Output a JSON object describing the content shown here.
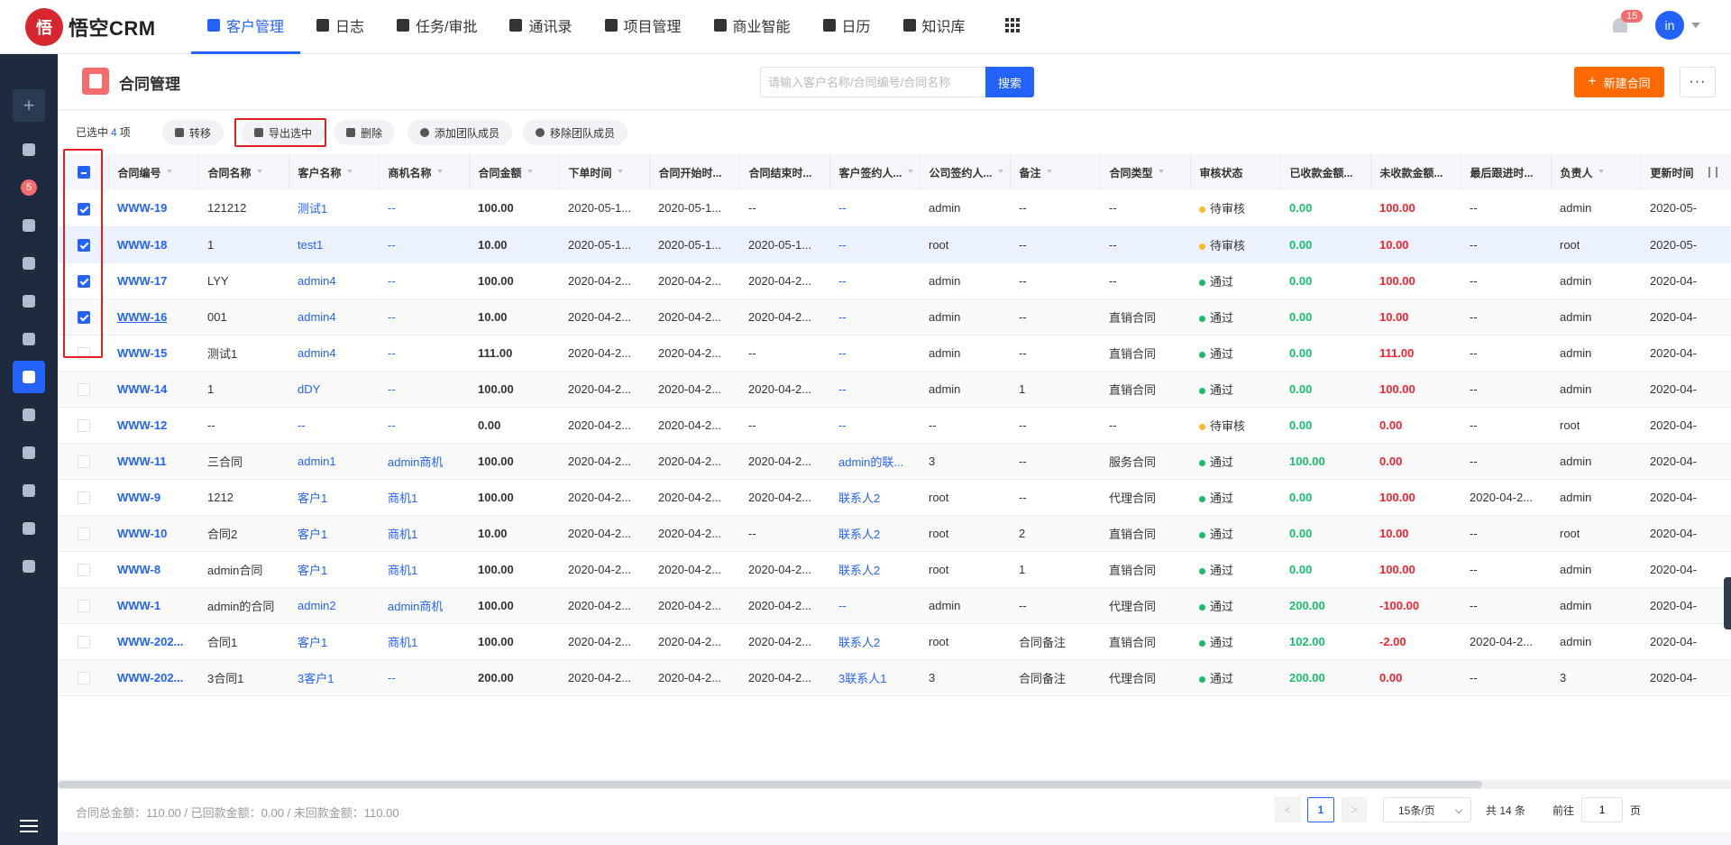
{
  "app": {
    "logo_text": "悟空CRM",
    "logo_mark": "悟"
  },
  "nav": [
    {
      "label": "客户管理",
      "active": true
    },
    {
      "label": "日志"
    },
    {
      "label": "任务/审批"
    },
    {
      "label": "通讯录"
    },
    {
      "label": "项目管理"
    },
    {
      "label": "商业智能"
    },
    {
      "label": "日历"
    },
    {
      "label": "知识库"
    }
  ],
  "notifications": {
    "count": "15"
  },
  "user": {
    "avatar_text": "in"
  },
  "sidebar": {
    "add_label": "+",
    "badge": "5"
  },
  "page": {
    "title": "合同管理"
  },
  "search": {
    "placeholder": "请输入客户名称/合同编号/合同名称",
    "button": "搜索"
  },
  "actions": {
    "new_label": "新建合同",
    "new_icon": "+",
    "more": "···"
  },
  "toolbar": {
    "selected_prefix": "已选中",
    "selected_count": "4",
    "selected_suffix": "项",
    "transfer": "转移",
    "export": "导出选中",
    "delete": "删除",
    "add_member": "添加团队成员",
    "remove_member": "移除团队成员"
  },
  "columns": [
    "合同编号",
    "合同名称",
    "客户名称",
    "商机名称",
    "合同金额",
    "下单时间",
    "合同开始时...",
    "合同结束时...",
    "客户签约人...",
    "公司签约人...",
    "备注",
    "合同类型",
    "审核状态",
    "已收款金额...",
    "未收款金额...",
    "最后跟进时...",
    "负责人",
    "更新时间"
  ],
  "rows": [
    {
      "checked": true,
      "code": "WWW-19",
      "name": "121212",
      "customer": "测试1",
      "opportunity": "--",
      "amount": "100.00",
      "order_time": "2020-05-1...",
      "start": "2020-05-1...",
      "end": "--",
      "cust_signer": "--",
      "comp_signer": "admin",
      "remark": "--",
      "type": "--",
      "status": "待审核",
      "status_kind": "pending",
      "received": "0.00",
      "unreceived": "100.00",
      "last_follow": "--",
      "owner": "admin",
      "updated": "2020-05-"
    },
    {
      "checked": true,
      "code": "WWW-18",
      "name": "1",
      "customer": "test1",
      "opportunity": "--",
      "amount": "10.00",
      "order_time": "2020-05-1...",
      "start": "2020-05-1...",
      "end": "2020-05-1...",
      "cust_signer": "--",
      "comp_signer": "root",
      "remark": "--",
      "type": "--",
      "status": "待审核",
      "status_kind": "pending",
      "received": "0.00",
      "unreceived": "10.00",
      "last_follow": "--",
      "owner": "root",
      "updated": "2020-05-"
    },
    {
      "checked": true,
      "code": "WWW-17",
      "name": "LYY",
      "customer": "admin4",
      "opportunity": "--",
      "amount": "100.00",
      "order_time": "2020-04-2...",
      "start": "2020-04-2...",
      "end": "2020-04-2...",
      "cust_signer": "--",
      "comp_signer": "admin",
      "remark": "--",
      "type": "--",
      "status": "通过",
      "status_kind": "pass",
      "received": "0.00",
      "unreceived": "100.00",
      "last_follow": "--",
      "owner": "admin",
      "updated": "2020-04-"
    },
    {
      "checked": true,
      "code": "WWW-16",
      "name": "001",
      "customer": "admin4",
      "opportunity": "--",
      "amount": "10.00",
      "order_time": "2020-04-2...",
      "start": "2020-04-2...",
      "end": "2020-04-2...",
      "cust_signer": "--",
      "comp_signer": "admin",
      "remark": "--",
      "type": "直销合同",
      "status": "通过",
      "status_kind": "pass",
      "received": "0.00",
      "unreceived": "10.00",
      "last_follow": "--",
      "owner": "admin",
      "updated": "2020-04-"
    },
    {
      "checked": false,
      "code": "WWW-15",
      "name": "测试1",
      "customer": "admin4",
      "opportunity": "--",
      "amount": "111.00",
      "order_time": "2020-04-2...",
      "start": "2020-04-2...",
      "end": "--",
      "cust_signer": "--",
      "comp_signer": "admin",
      "remark": "--",
      "type": "直销合同",
      "status": "通过",
      "status_kind": "pass",
      "received": "0.00",
      "unreceived": "111.00",
      "last_follow": "--",
      "owner": "admin",
      "updated": "2020-04-"
    },
    {
      "checked": false,
      "code": "WWW-14",
      "name": "1",
      "customer": "dDY",
      "opportunity": "--",
      "amount": "100.00",
      "order_time": "2020-04-2...",
      "start": "2020-04-2...",
      "end": "2020-04-2...",
      "cust_signer": "--",
      "comp_signer": "admin",
      "remark": "1",
      "type": "直销合同",
      "status": "通过",
      "status_kind": "pass",
      "received": "0.00",
      "unreceived": "100.00",
      "last_follow": "--",
      "owner": "admin",
      "updated": "2020-04-"
    },
    {
      "checked": false,
      "code": "WWW-12",
      "name": "--",
      "customer": "--",
      "opportunity": "--",
      "amount": "0.00",
      "order_time": "2020-04-2...",
      "start": "2020-04-2...",
      "end": "--",
      "cust_signer": "--",
      "comp_signer": "--",
      "remark": "--",
      "type": "--",
      "status": "待审核",
      "status_kind": "pending",
      "received": "0.00",
      "unreceived": "0.00",
      "last_follow": "--",
      "owner": "root",
      "updated": "2020-04-"
    },
    {
      "checked": false,
      "code": "WWW-11",
      "name": "三合同",
      "customer": "admin1",
      "opportunity": "admin商机",
      "amount": "100.00",
      "order_time": "2020-04-2...",
      "start": "2020-04-2...",
      "end": "2020-04-2...",
      "cust_signer": "admin的联...",
      "comp_signer": "3",
      "remark": "--",
      "type": "服务合同",
      "status": "通过",
      "status_kind": "pass",
      "received": "100.00",
      "unreceived": "0.00",
      "last_follow": "--",
      "owner": "admin",
      "updated": "2020-04-"
    },
    {
      "checked": false,
      "code": "WWW-9",
      "name": "1212",
      "customer": "客户1",
      "opportunity": "商机1",
      "amount": "100.00",
      "order_time": "2020-04-2...",
      "start": "2020-04-2...",
      "end": "2020-04-2...",
      "cust_signer": "联系人2",
      "comp_signer": "root",
      "remark": "--",
      "type": "代理合同",
      "status": "通过",
      "status_kind": "pass",
      "received": "0.00",
      "unreceived": "100.00",
      "last_follow": "2020-04-2...",
      "owner": "admin",
      "updated": "2020-04-"
    },
    {
      "checked": false,
      "code": "WWW-10",
      "name": "合同2",
      "customer": "客户1",
      "opportunity": "商机1",
      "amount": "10.00",
      "order_time": "2020-04-2...",
      "start": "2020-04-2...",
      "end": "--",
      "cust_signer": "联系人2",
      "comp_signer": "root",
      "remark": "2",
      "type": "直销合同",
      "status": "通过",
      "status_kind": "pass",
      "received": "0.00",
      "unreceived": "10.00",
      "last_follow": "--",
      "owner": "root",
      "updated": "2020-04-"
    },
    {
      "checked": false,
      "code": "WWW-8",
      "name": "admin合同",
      "customer": "客户1",
      "opportunity": "商机1",
      "amount": "100.00",
      "order_time": "2020-04-2...",
      "start": "2020-04-2...",
      "end": "2020-04-2...",
      "cust_signer": "联系人2",
      "comp_signer": "root",
      "remark": "1",
      "type": "直销合同",
      "status": "通过",
      "status_kind": "pass",
      "received": "0.00",
      "unreceived": "100.00",
      "last_follow": "--",
      "owner": "admin",
      "updated": "2020-04-"
    },
    {
      "checked": false,
      "code": "WWW-1",
      "name": "admin的合同",
      "customer": "admin2",
      "opportunity": "admin商机",
      "amount": "100.00",
      "order_time": "2020-04-2...",
      "start": "2020-04-2...",
      "end": "2020-04-2...",
      "cust_signer": "--",
      "comp_signer": "admin",
      "remark": "--",
      "type": "代理合同",
      "status": "通过",
      "status_kind": "pass",
      "received": "200.00",
      "unreceived": "-100.00",
      "last_follow": "--",
      "owner": "admin",
      "updated": "2020-04-"
    },
    {
      "checked": false,
      "code": "WWW-202...",
      "name": "合同1",
      "customer": "客户1",
      "opportunity": "商机1",
      "amount": "100.00",
      "order_time": "2020-04-2...",
      "start": "2020-04-2...",
      "end": "2020-04-2...",
      "cust_signer": "联系人2",
      "comp_signer": "root",
      "remark": "合同备注",
      "type": "直销合同",
      "status": "通过",
      "status_kind": "pass",
      "received": "102.00",
      "unreceived": "-2.00",
      "last_follow": "2020-04-2...",
      "owner": "admin",
      "updated": "2020-04-"
    },
    {
      "checked": false,
      "code": "WWW-202...",
      "name": "3合同1",
      "customer": "3客户1",
      "opportunity": "--",
      "amount": "200.00",
      "order_time": "2020-04-2...",
      "start": "2020-04-2...",
      "end": "2020-04-2...",
      "cust_signer": "3联系人1",
      "comp_signer": "3",
      "remark": "合同备注",
      "type": "代理合同",
      "status": "通过",
      "status_kind": "pass",
      "received": "200.00",
      "unreceived": "0.00",
      "last_follow": "--",
      "owner": "3",
      "updated": "2020-04-"
    }
  ],
  "footer": {
    "summary": "合同总金额：110.00 / 已回款金额：0.00 / 未回款金额：110.00",
    "prev": "<",
    "page": "1",
    "next": ">",
    "page_size": "15条/页",
    "total": "共 14 条",
    "goto_prefix": "前往",
    "goto_value": "1",
    "goto_suffix": "页"
  },
  "colors": {
    "primary": "#2362fb",
    "orange": "#ff6a00",
    "success": "#19be6b",
    "danger": "#f5222d",
    "warning": "#fcb828",
    "sidebar_bg": "#1e2a3d"
  }
}
